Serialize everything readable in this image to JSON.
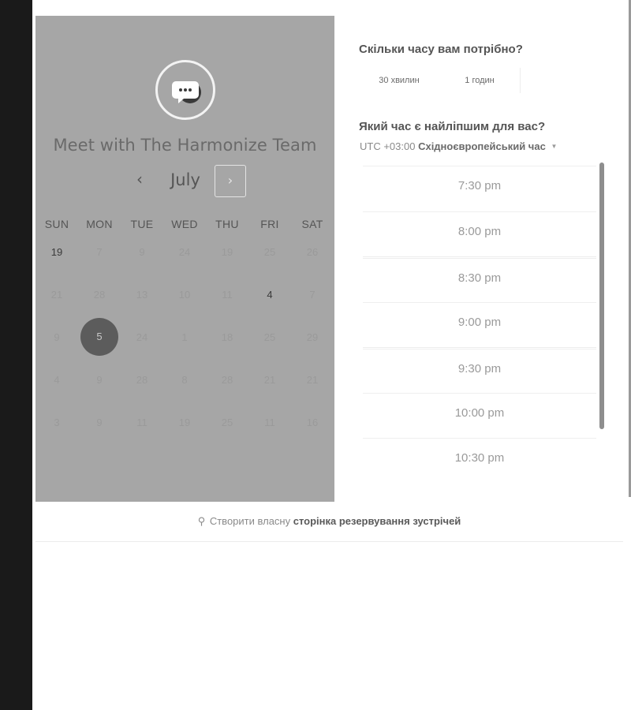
{
  "calendar": {
    "title": "Meet with The Harmonize Team",
    "month": "July",
    "prev_symbol": "‹",
    "next_symbol": "›",
    "weekdays": [
      "SUN",
      "MON",
      "TUE",
      "WED",
      "THU",
      "FRI",
      "SAT"
    ],
    "weeks": [
      [
        "19",
        "7",
        "9",
        "24",
        "19",
        "25",
        "26"
      ],
      [
        "21",
        "28",
        "13",
        "10",
        "11",
        "4",
        "7"
      ],
      [
        "9",
        "5",
        "24",
        "1",
        "18",
        "25",
        "29"
      ],
      [
        "4",
        "9",
        "28",
        "8",
        "28",
        "21",
        "21"
      ],
      [
        "3",
        "9",
        "11",
        "19",
        "25",
        "11",
        "16"
      ]
    ],
    "selected_day": "5",
    "available_days": [
      "19",
      "4"
    ]
  },
  "duration": {
    "question": "Скільки часу вам потрібно?",
    "options": [
      "30 хвилин",
      "1 годин"
    ]
  },
  "time": {
    "question": "Який час є найліпшим для вас?",
    "timezone_offset": "UTC +03:00",
    "timezone_name": "Східноєвропейський час",
    "slots": [
      "7:30 pm",
      "8:00 pm",
      "8:30 pm",
      "9:00 pm",
      "9:30 pm",
      "10:00 pm",
      "10:30 pm"
    ]
  },
  "footer": {
    "icon": "hubspot-sprocket-icon",
    "text": "Створити власну",
    "link": "сторінка резервування зустрічей"
  },
  "colors": {
    "panel_bg": "#a6a6a6",
    "selected_day_bg": "#5c5c5c",
    "left_bar": "#1a1a1a"
  }
}
